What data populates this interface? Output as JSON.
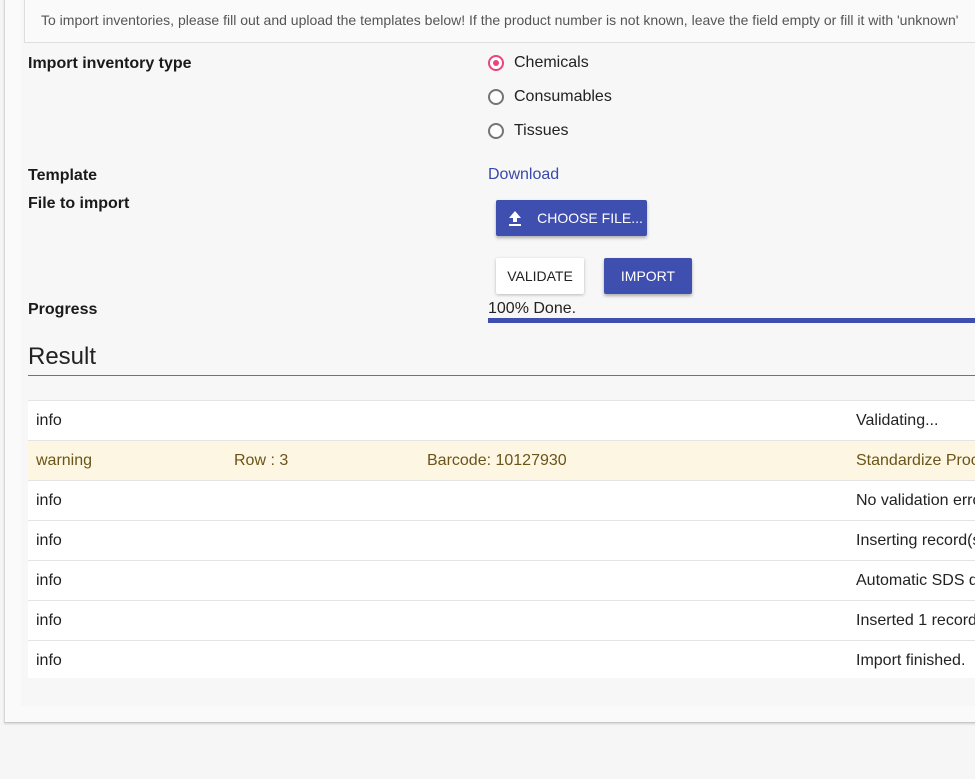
{
  "notice": "To import inventories, please fill out and upload the templates below! If the product number is not known, leave the field empty or fill it with 'unknown'",
  "labels": {
    "inventory_type": "Import inventory type",
    "template": "Template",
    "file": "File to import",
    "progress": "Progress"
  },
  "inventory_types": [
    {
      "label": "Chemicals",
      "selected": true
    },
    {
      "label": "Consumables",
      "selected": false
    },
    {
      "label": "Tissues",
      "selected": false
    }
  ],
  "template_link": "Download",
  "buttons": {
    "choose_file": "CHOOSE FILE...",
    "validate": "VALIDATE",
    "import": "IMPORT"
  },
  "progress": {
    "text": "100% Done.",
    "value": 1.0
  },
  "result": {
    "title": "Result",
    "rows": [
      {
        "level": "info",
        "row": "",
        "barcode": "",
        "message": "Validating..."
      },
      {
        "level": "warning",
        "row": "Row : 3",
        "barcode": "Barcode: 10127930",
        "message": "Standardize Proc"
      },
      {
        "level": "info",
        "row": "",
        "barcode": "",
        "message": "No validation erro"
      },
      {
        "level": "info",
        "row": "",
        "barcode": "",
        "message": "Inserting record(s"
      },
      {
        "level": "info",
        "row": "",
        "barcode": "",
        "message": "Automatic SDS d"
      },
      {
        "level": "info",
        "row": "",
        "barcode": "",
        "message": "Inserted 1 record"
      },
      {
        "level": "info",
        "row": "",
        "barcode": "",
        "message": "Import finished."
      }
    ]
  },
  "colors": {
    "primary": "#3f4fb0",
    "radio_selected": "#e8457a",
    "warning_bg": "#fdf6e3",
    "link": "#3949ab"
  }
}
